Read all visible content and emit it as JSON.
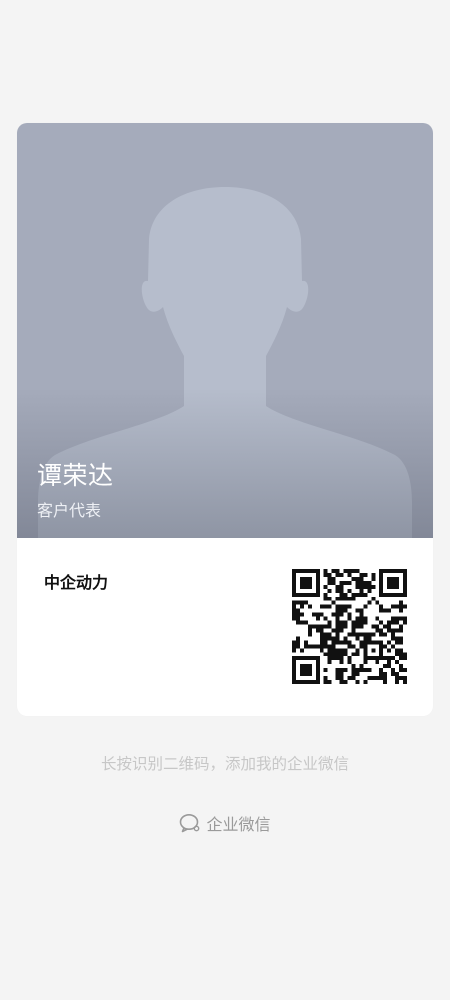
{
  "profile": {
    "name": "谭荣达",
    "title": "客户代表",
    "company": "中企动力",
    "avatar_icon": "person-silhouette-icon"
  },
  "qr": {
    "icon": "qr-code-icon"
  },
  "footer": {
    "hint": "长按识别二维码，添加我的企业微信",
    "brand_label": "企业微信",
    "brand_icon": "wecom-logo-icon"
  },
  "colors": {
    "background": "#f4f4f4",
    "photo_background": "#a5abbb",
    "silhouette": "#b6bdcc",
    "hint_text": "#c7c7c7",
    "brand_text": "#9a9a9a"
  }
}
